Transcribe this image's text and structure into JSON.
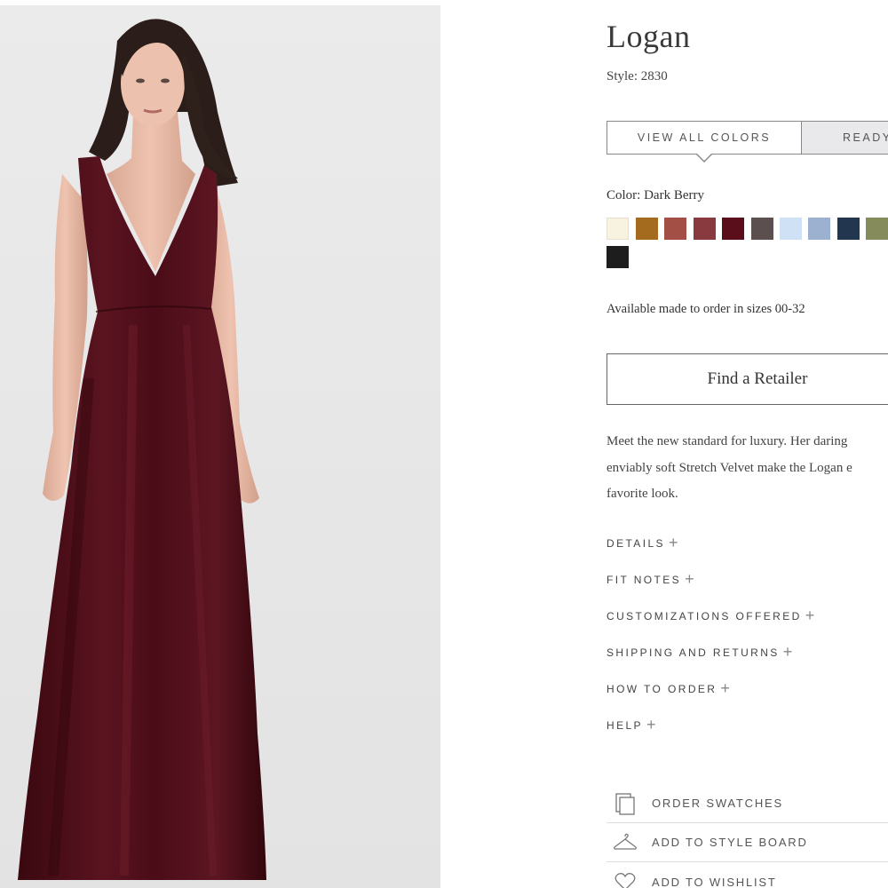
{
  "product": {
    "name": "Logan",
    "style_label": "Style: 2830"
  },
  "tabs": [
    {
      "label": "VIEW ALL COLORS",
      "active": true
    },
    {
      "label": "READY",
      "active": false
    }
  ],
  "color": {
    "label": "Color: Dark Berry",
    "swatches": [
      {
        "name": "ivory",
        "hex": "#f8f2e1"
      },
      {
        "name": "amber",
        "hex": "#a46a1e"
      },
      {
        "name": "terracotta",
        "hex": "#a34f45"
      },
      {
        "name": "rosewood",
        "hex": "#883a3f"
      },
      {
        "name": "dark-berry",
        "hex": "#5a0e1c"
      },
      {
        "name": "taupe",
        "hex": "#5b4f50"
      },
      {
        "name": "pale-blue",
        "hex": "#cfe1f4"
      },
      {
        "name": "dusty-blue",
        "hex": "#9bb1cf"
      },
      {
        "name": "navy",
        "hex": "#233650"
      },
      {
        "name": "moss",
        "hex": "#868b5c"
      },
      {
        "name": "black",
        "hex": "#1d1d1d"
      }
    ]
  },
  "availability": "Available made to order in sizes 00-32",
  "retailer_button": "Find a Retailer",
  "description": {
    "line1": "Meet the new standard for luxury. Her daring",
    "line2": "enviably soft Stretch Velvet make the Logan e",
    "line3": "favorite look."
  },
  "accordion": [
    {
      "label": "DETAILS"
    },
    {
      "label": "FIT NOTES"
    },
    {
      "label": "CUSTOMIZATIONS OFFERED"
    },
    {
      "label": "SHIPPING AND RETURNS"
    },
    {
      "label": "HOW TO ORDER"
    },
    {
      "label": "HELP"
    }
  ],
  "actions": [
    {
      "label": "ORDER SWATCHES",
      "icon": "swatches-icon"
    },
    {
      "label": "ADD TO STYLE BOARD",
      "icon": "hanger-icon"
    },
    {
      "label": "ADD TO WISHLIST",
      "icon": "heart-icon"
    }
  ],
  "colors": {
    "dress": "#4a0c16",
    "background": "#e8e8e8",
    "text": "#333333",
    "border": "#888888"
  }
}
